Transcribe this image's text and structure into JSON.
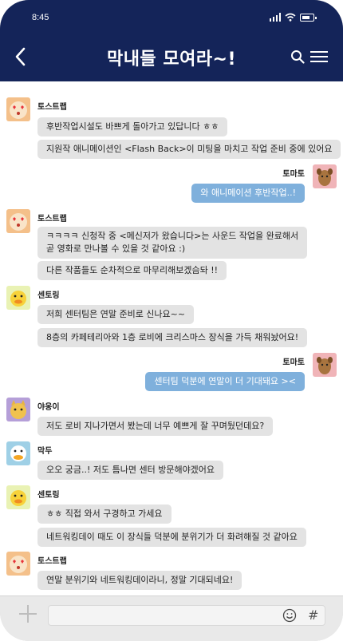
{
  "status": {
    "time": "8:45"
  },
  "header": {
    "title": "막내들 모여라~!"
  },
  "messages": [
    {
      "sender": "토스트랩",
      "avatar": "heart-eyes-character",
      "side": "left",
      "bubbles": [
        "후반작업시설도 바쁘게 돌아가고 있답니다 ㅎㅎ",
        "지원작 애니메이션인 <Flash Back>이 미팅을 마치고 작업 준비 중에 있어요"
      ]
    },
    {
      "sender": "토마토",
      "avatar": "brown-dog-character",
      "side": "right",
      "bubbles": [
        "와 애니메이션 후반작업..!"
      ]
    },
    {
      "sender": "토스트랩",
      "avatar": "heart-eyes-character",
      "side": "left",
      "bubbles": [
        "ㅋㅋㅋㅋ 신청작 중 <메신저가 왔습니다>는 사운드 작업을 완료해서\n곧 영화로 만나볼 수 있을 것 같아요 :)",
        "다른 작품들도 순차적으로 마무리해보겠슴돠 !!"
      ]
    },
    {
      "sender": "센토링",
      "avatar": "yellow-duck-character",
      "side": "left",
      "bubbles": [
        "저희 센터팀은 연말 준비로 신나요~~",
        "8층의 카페테리아와 1층 로비에 크리스마스 장식을 가득 채워놨어요!"
      ]
    },
    {
      "sender": "토마토",
      "avatar": "brown-dog-character",
      "side": "right",
      "bubbles": [
        "센터팀 덕분에 연말이 더 기대돼요 ><"
      ]
    },
    {
      "sender": "야옹이",
      "avatar": "cat-character",
      "side": "left",
      "bubbles": [
        "저도 로비 지나가면서 봤는데 너무 예쁘게 잘 꾸며뒀던데요?"
      ]
    },
    {
      "sender": "막두",
      "avatar": "white-duck-character",
      "side": "left",
      "bubbles": [
        "오오 궁금..! 저도 틈나면 센터 방문해야겠어요"
      ]
    },
    {
      "sender": "센토링",
      "avatar": "yellow-duck-character",
      "side": "left",
      "bubbles": [
        "ㅎㅎ 직접 와서 구경하고 가세요",
        "네트워킹데이 때도 이 장식들 덕분에 분위기가 더 화려해질 것 같아요"
      ]
    },
    {
      "sender": "토스트랩",
      "avatar": "heart-eyes-character",
      "side": "left",
      "bubbles": [
        "연말 분위기와 네트워킹데이라니, 정말 기대되네요!"
      ]
    }
  ],
  "input": {
    "hash_symbol": "#"
  },
  "colors": {
    "header_bg": "#142459",
    "my_bubble": "#7fb0dc",
    "other_bubble": "#e3e3e3"
  }
}
